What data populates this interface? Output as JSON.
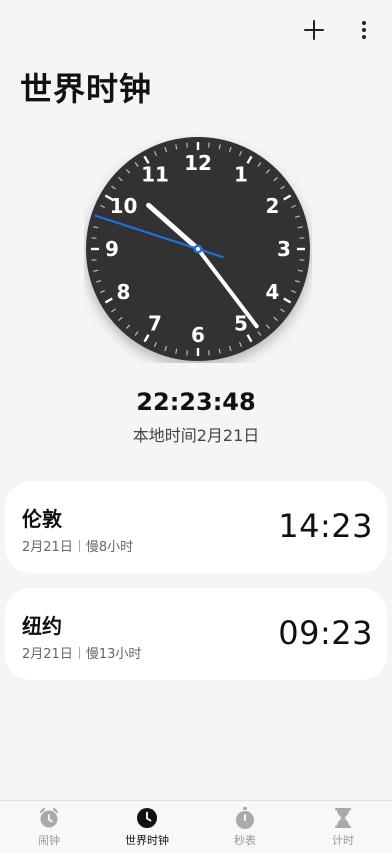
{
  "header": {
    "title": "世界时钟",
    "add_icon": "plus-icon",
    "more_icon": "more-vertical-icon"
  },
  "clock": {
    "digital_time": "22:23:48",
    "date_label": "本地时间2月21日",
    "numbers": [
      "12",
      "1",
      "2",
      "3",
      "4",
      "5",
      "6",
      "7",
      "8",
      "9",
      "10",
      "11"
    ],
    "hour": 22,
    "minute": 23,
    "second": 48,
    "face_color": "#333333",
    "second_hand_color": "#1f6fe0"
  },
  "cities": [
    {
      "name": "伦敦",
      "date": "2月21日",
      "offset": "慢8小时",
      "time": "14:23"
    },
    {
      "name": "纽约",
      "date": "2月21日",
      "offset": "慢13小时",
      "time": "09:23"
    }
  ],
  "nav": {
    "items": [
      {
        "label": "闹钟",
        "icon": "alarm-icon"
      },
      {
        "label": "世界时钟",
        "icon": "clock-icon",
        "active": true
      },
      {
        "label": "秒表",
        "icon": "stopwatch-icon"
      },
      {
        "label": "计时",
        "icon": "hourglass-icon"
      }
    ]
  }
}
